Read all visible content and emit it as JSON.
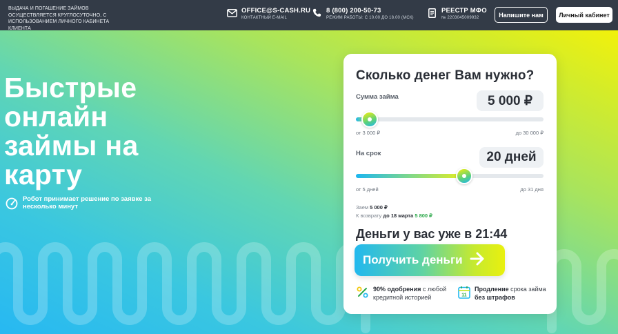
{
  "header": {
    "note": "Выдача и погашение займов осуществляется круглосуточно, с использованием личного кабинета клиента",
    "email": {
      "icon": "mail-icon",
      "title": "OFFICE@S-CASH.RU",
      "subtitle": "Контактный E-mail"
    },
    "phone": {
      "icon": "phone-icon",
      "title": "8 (800) 200-50-73",
      "subtitle": "Режим работы: с 10.00 до 18.00 (МСК)"
    },
    "registry": {
      "icon": "document-icon",
      "title": "РЕЕСТР МФО",
      "subtitle": "№ 2203045009932"
    },
    "write_label": "Напишите нам",
    "cabinet_label": "Личный кабинет"
  },
  "hero": {
    "title": "Быстрые онлайн займы на карту",
    "robot_text": "Робот принимает решение по заявке за несколько минут"
  },
  "calculator": {
    "title": "Сколько денег Вам нужно?",
    "amount": {
      "label": "Сумма займа",
      "value": "5 000 ₽",
      "min_label": "от 3 000 ₽",
      "max_label": "до 30 000 ₽",
      "level": 0.074
    },
    "term": {
      "label": "На срок",
      "value": "20 дней",
      "min_label": "от 5 дней",
      "max_label": "до 31 дня",
      "level": 0.577
    },
    "summary_loan_label": "Заем",
    "summary_loan_value": "5 000 ₽",
    "summary_return_label": "К возврату",
    "summary_return_date": "до 18 марта",
    "summary_return_value": "5 800 ₽",
    "ready_text": "Деньги у вас уже в 21:44",
    "cta_label": "Получить деньги",
    "feature1_bold": "90% одобрения",
    "feature1_text": "с любой кредитной историей",
    "feature2_bold": "Продление",
    "feature2_text": "срока займа",
    "feature2_bold2": "без штрафов"
  },
  "colors": {
    "header_bg": "#333b47",
    "accent_green": "#2ba84a",
    "gradient_blue": "#27b8f2",
    "gradient_yellow": "#f2f10b"
  }
}
